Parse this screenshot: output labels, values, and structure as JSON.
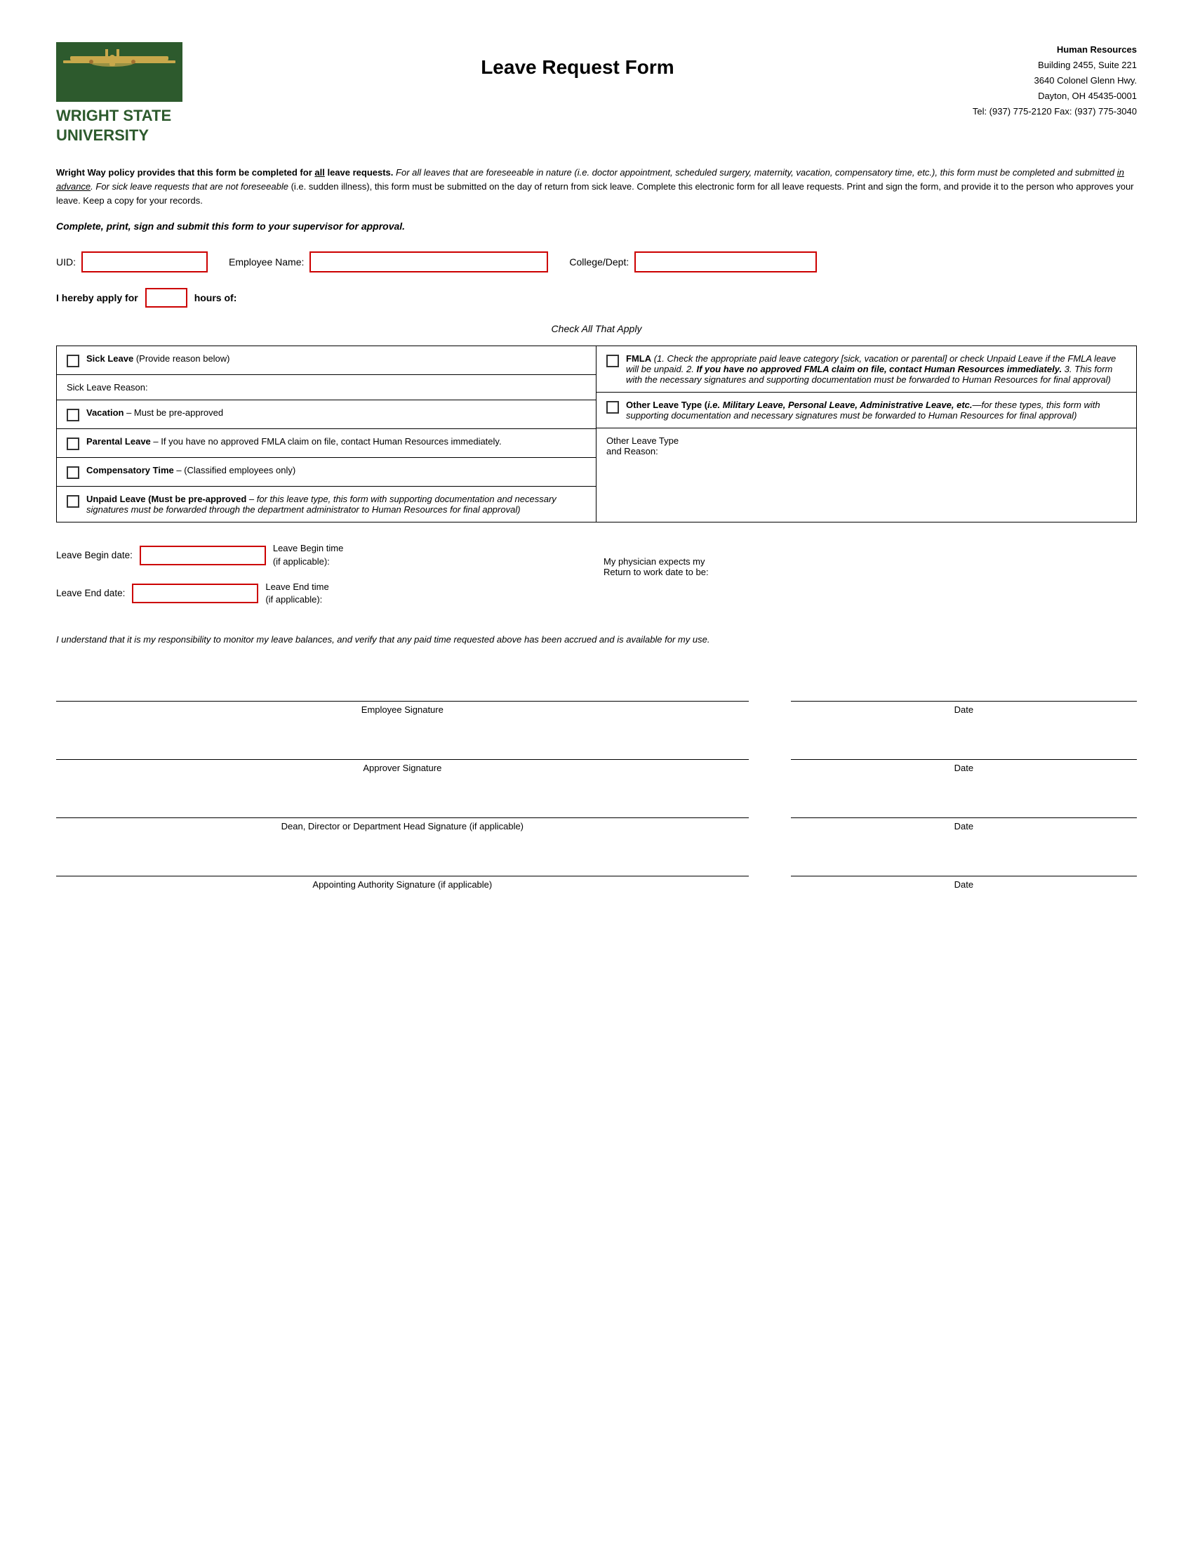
{
  "header": {
    "university_name_line1": "WRIGHT STATE",
    "university_name_line2": "UNIVERSITY",
    "form_title": "Leave Request Form",
    "hr": {
      "dept": "Human Resources",
      "line1": "Building 2455, Suite 221",
      "line2": "3640 Colonel Glenn Hwy.",
      "line3": "Dayton, OH 45435-0001",
      "line4": "Tel: (937) 775-2120  Fax: (937) 775-3040"
    }
  },
  "policy": {
    "bold_text": "Wright Way policy provides that this form be completed for all leave requests.",
    "italic_text": " For all leaves that are foreseeable in nature (i.e. doctor appointment, scheduled surgery, maternity, vacation, compensatory time, etc.), this form must be completed and submitted ",
    "underline_text": "in advance",
    "italic_text2": ".  For sick leave requests that are not foreseeable",
    "normal_text": " (i.e. sudden illness), this form must be submitted on the day of return from sick leave.  Complete this electronic form for all leave requests.  Print and sign the form, and provide it to the person who approves your leave.  Keep a copy for your records."
  },
  "submit_instruction": "Complete, print, sign and submit this form to your supervisor for approval.",
  "fields": {
    "uid_label": "UID:",
    "emp_name_label": "Employee Name:",
    "college_dept_label": "College/Dept:"
  },
  "hours_row": {
    "prefix": "I hereby apply for",
    "suffix": "hours of:"
  },
  "check_all": "Check All That Apply",
  "leave_options": {
    "sick_leave": {
      "label": "Sick Leave",
      "detail": " (Provide reason below)"
    },
    "sick_reason_label": "Sick Leave Reason:",
    "vacation": {
      "label": "Vacation",
      "detail": " – Must be pre-approved"
    },
    "parental": {
      "label": "Parental Leave",
      "detail": " – If you have no approved FMLA claim on file, contact Human Resources immediately."
    },
    "comp_time": {
      "label": "Compensatory Time",
      "detail": " – (Classified employees only)"
    },
    "unpaid": {
      "label": "Unpaid Leave (Must be pre-approved",
      "detail": " – for this leave type, this form with supporting documentation and necessary signatures must be forwarded through the department administrator to Human Resources for final approval)"
    },
    "fmla": {
      "bold_label": "FMLA",
      "detail": " (1. Check the appropriate paid leave category [sick, vacation or parental] or check Unpaid Leave if the FMLA leave will be unpaid.  2. ",
      "bold2": "If you have no approved FMLA claim on file, contact Human Resources immediately.",
      "detail2": "  3. This form with the necessary signatures and supporting documentation must be forwarded to Human Resources for final approval)"
    },
    "other_leave": {
      "bold_label": "Other Leave Type",
      "paren_label": " (i.e. Military Leave, Personal Leave, Administrative Leave, etc.",
      "detail": "—for these types, this form with supporting documentation and necessary signatures must be forwarded to Human Resources for final approval)"
    },
    "other_reason_label": "Other Leave Type\nand Reason:"
  },
  "date_fields": {
    "begin_label": "Leave Begin date:",
    "begin_time_label": "Leave Begin time\n(if applicable):",
    "end_label": "Leave End date:",
    "end_time_label": "Leave End time\n(if applicable):",
    "physician_label": "My physician expects my\nReturn to work date to be:"
  },
  "disclaimer": "I understand that it is my responsibility to monitor my leave balances, and verify that any paid time requested above has been accrued and is available for my use.",
  "signatures": [
    {
      "line_label": "Employee Signature",
      "date_label": "Date"
    },
    {
      "line_label": "Approver Signature",
      "date_label": "Date"
    },
    {
      "line_label": "Dean, Director or Department Head Signature (if applicable)",
      "date_label": "Date"
    },
    {
      "line_label": "Appointing Authority Signature (if applicable)",
      "date_label": "Date"
    }
  ]
}
